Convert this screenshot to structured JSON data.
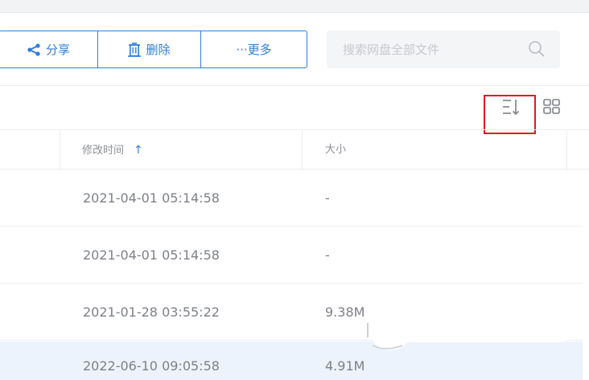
{
  "toolbar": {
    "share_label": "分享",
    "delete_label": "删除",
    "more_label": "···更多"
  },
  "search": {
    "placeholder": "搜索网盘全部文件"
  },
  "view": {
    "sort_icon": "sort-icon",
    "grid_icon": "grid-view-icon"
  },
  "table": {
    "columns": {
      "mtime": "修改时间",
      "size": "大小"
    },
    "sort_indicator": "↑",
    "rows": [
      {
        "mtime": "2021-04-01 05:14:58",
        "size": "-"
      },
      {
        "mtime": "2021-04-01 05:14:58",
        "size": "-"
      },
      {
        "mtime": "2021-01-28 03:55:22",
        "size": "9.38M"
      },
      {
        "mtime": "2022-06-10 09:05:58",
        "size": "4.91M"
      }
    ]
  },
  "colors": {
    "accent": "#2f7de1",
    "highlight": "#e6161f",
    "selected_row": "#edf3fd"
  }
}
